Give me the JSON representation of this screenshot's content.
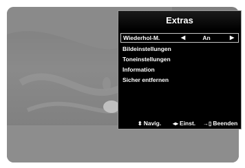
{
  "menu": {
    "title": "Extras",
    "items": [
      {
        "label": "Wiederhol-M.",
        "value": "An"
      },
      {
        "label": "Bildeinstellungen"
      },
      {
        "label": "Toneinstellungen"
      },
      {
        "label": "Information"
      },
      {
        "label": "Sicher entfernen"
      }
    ]
  },
  "footer": {
    "navigate": "Navig.",
    "adjust": "Einst.",
    "exit": "Beenden"
  },
  "icons": {
    "navigate": "up-down-arrow-icon",
    "adjust": "left-right-arrow-icon",
    "exit": "exit-icon"
  },
  "colors": {
    "panel_bg": "#000000",
    "screen_bg": "#808080",
    "text": "#ffffff"
  }
}
